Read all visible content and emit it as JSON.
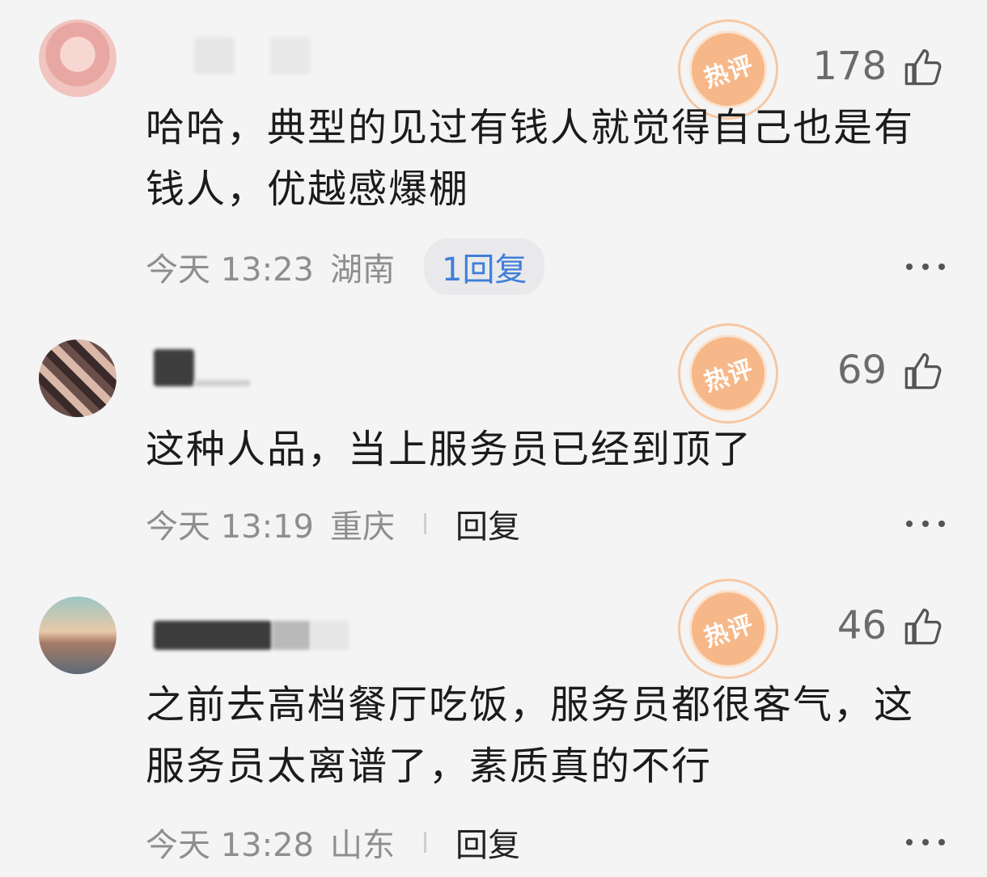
{
  "comments": [
    {
      "hot_label": "热评",
      "likes": "178",
      "text": "哈哈，典型的见过有钱人就觉得自己也是有钱人，优越感爆棚",
      "time": "今天 13:23",
      "location": "湖南",
      "reply_label": "1回复"
    },
    {
      "hot_label": "热评",
      "likes": "69",
      "text": "这种人品，当上服务员已经到顶了",
      "time": "今天 13:19",
      "location": "重庆",
      "reply_label": "回复"
    },
    {
      "hot_label": "热评",
      "likes": "46",
      "text": "之前去高档餐厅吃饭，服务员都很客气，这服务员太离谱了，素质真的不行",
      "time": "今天 13:28",
      "location": "山东",
      "reply_label": "回复"
    }
  ],
  "icons": {
    "like": "thumbs-up-icon",
    "more": "more-dots-icon",
    "hot": "hot-comment-badge"
  },
  "colors": {
    "hot_badge": "#f6b889",
    "reply_pill_text": "#3f7fd8",
    "meta_text": "#8e8e8e"
  }
}
